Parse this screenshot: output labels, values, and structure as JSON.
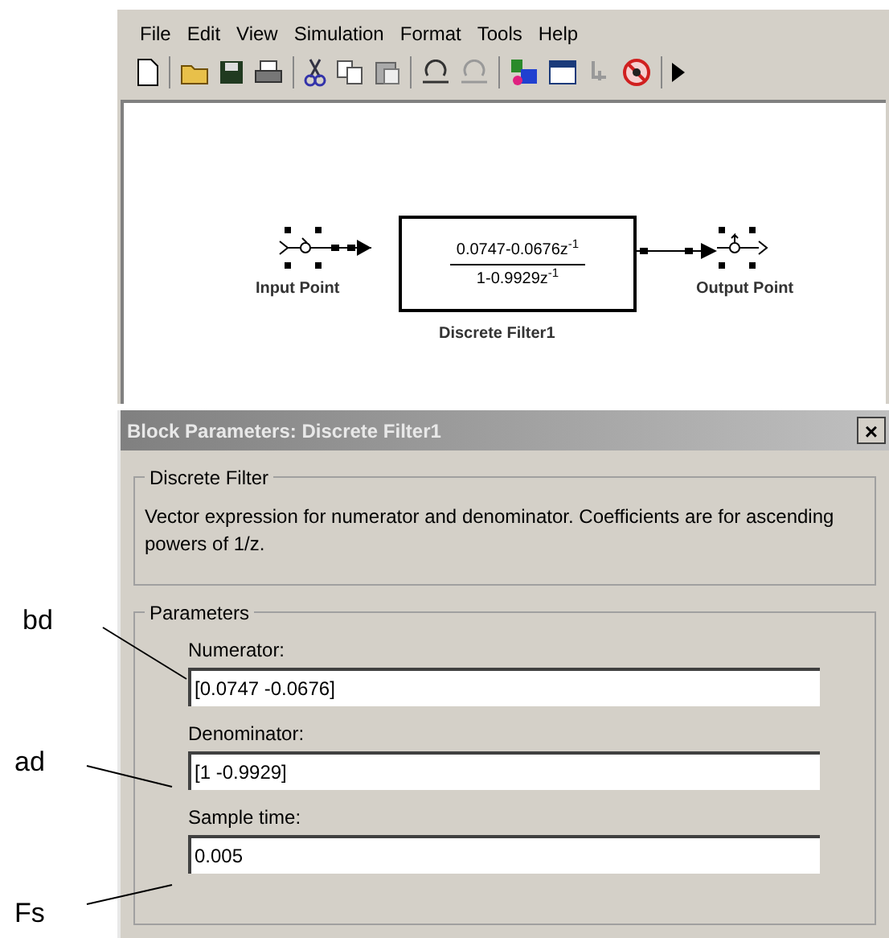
{
  "menu": [
    "File",
    "Edit",
    "View",
    "Simulation",
    "Format",
    "Tools",
    "Help"
  ],
  "diagram": {
    "input_label": "Input Point",
    "block": {
      "numerator": "0.0747-0.0676z$^{-1}$",
      "denominator": "1-0.9929z$^{-1}$",
      "name": "Discrete Filter1"
    },
    "output_label": "Output Point"
  },
  "dialog": {
    "title": "Block Parameters: Discrete Filter1",
    "close": "×",
    "description_group": {
      "title": "Discrete Filter",
      "text": "Vector expression for numerator and denominator.  Coefficients are for ascending powers of 1/z."
    },
    "parameters_group": {
      "title": "Parameters",
      "fields": [
        {
          "label": "Numerator:",
          "value": "[0.0747 -0.0676]"
        },
        {
          "label": "Denominator:",
          "value": "[1 -0.9929]"
        },
        {
          "label": "Sample time:",
          "value": "0.005"
        }
      ]
    }
  },
  "annotations": [
    "bd",
    "ad",
    "Fs"
  ]
}
